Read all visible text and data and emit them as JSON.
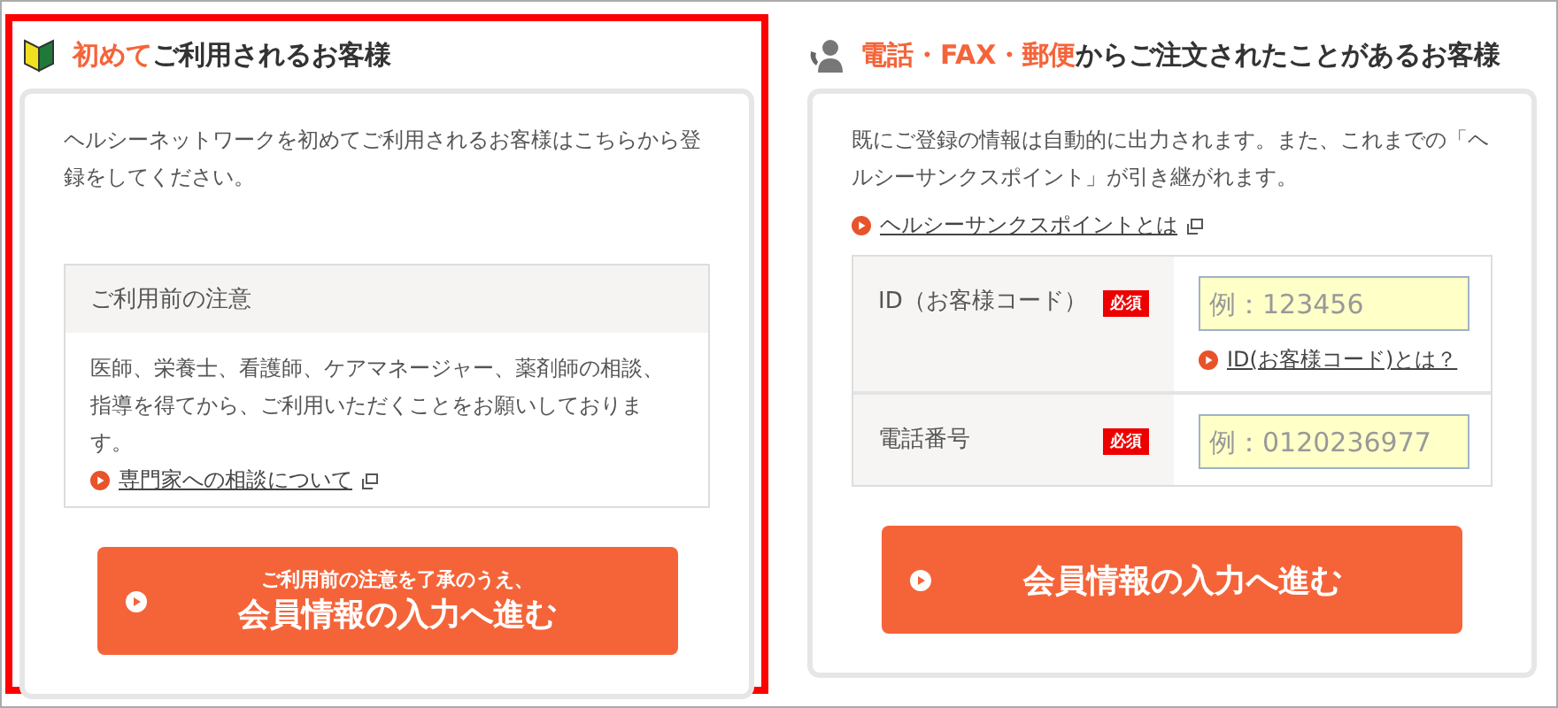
{
  "sections": [
    {
      "kind": "first",
      "highlighted": true,
      "title_accent": "初めて",
      "title_rest": "ご利用されるお客様",
      "description": "ヘルシーネットワークを初めてご利用されるお客様はこちらから登録をしてください。",
      "notice": {
        "heading": "ご利用前の注意",
        "body": "医師、栄養士、看護師、ケアマネージャー、薬剤師の相談、指導を得てから、ご利用いただくことをお願いしております。",
        "link": "専門家への相談について"
      },
      "button": {
        "subtitle": "ご利用前の注意を了承のうえ、",
        "label": "会員情報の入力へ進む"
      }
    },
    {
      "kind": "returning",
      "highlighted": false,
      "title_accent": "電話・FAX・郵便",
      "title_rest": "からご注文されたことがあるお客様",
      "description": "既にご登録の情報は自動的に出力されます。また、これまでの「ヘルシーサンクスポイント」が引き継がれます。",
      "link": "ヘルシーサンクスポイントとは",
      "form": [
        {
          "label": "ID（お客様コード）",
          "badge": "必須",
          "placeholder": "例：123456",
          "help_link": "ID(お客様コード)とは？"
        },
        {
          "label": "電話番号",
          "badge": "必須",
          "placeholder": "例：0120236977"
        }
      ],
      "button": {
        "label": "会員情報の入力へ進む"
      }
    }
  ]
}
